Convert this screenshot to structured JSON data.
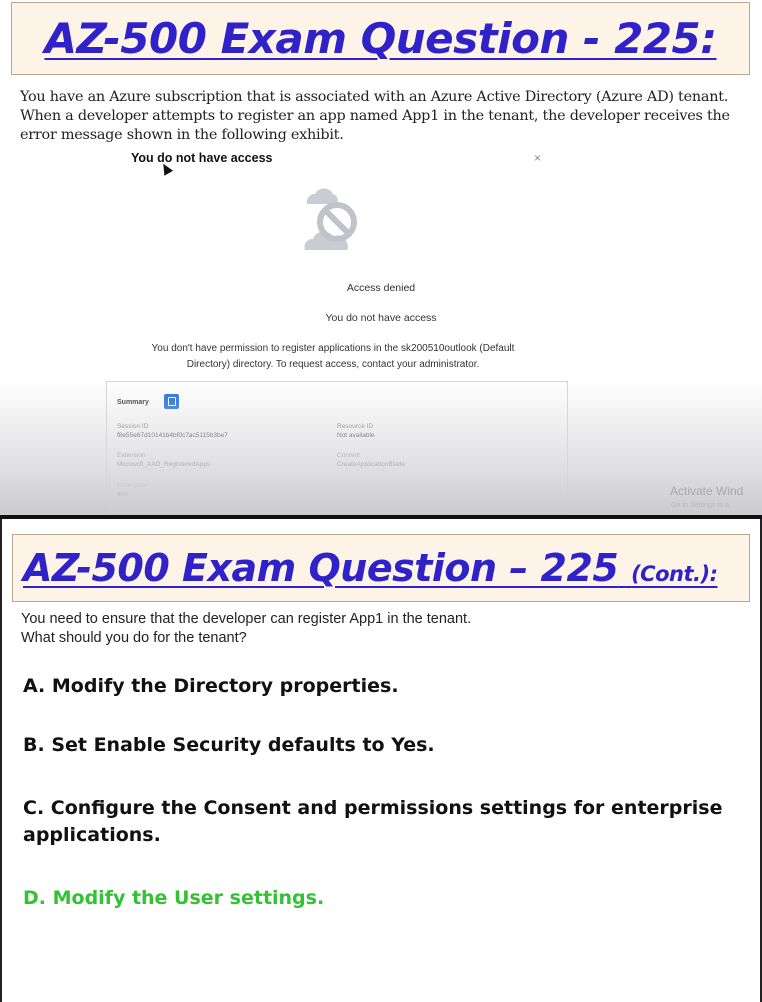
{
  "slide1": {
    "title": "AZ-500 Exam Question - 225:",
    "question_lines": [
      "You have an Azure subscription that is associated with an Azure Active Directory (Azure AD) tenant.",
      "When a developer attempts to register an app named App1 in the tenant, the developer receives the",
      "error message shown in the following exhibit."
    ],
    "exhibit": {
      "title": "You do not have access",
      "close_glyph": "×",
      "icon": "cloud-blocked-icon",
      "heading": "Access denied",
      "subheading": "You do not have access",
      "description_lines": [
        "You don't have permission to register applications in the sk200510outlook (Default",
        "Directory) directory. To request access, contact your administrator."
      ],
      "summary": {
        "label": "Summary",
        "session_id_label": "Session ID",
        "session_id_value": "f8e55e67d10141b4bf0c7ac5115b3be7",
        "resource_id_label": "Resource ID",
        "resource_id_value": "Not available",
        "extension_label": "Extension",
        "extension_value": "Microsoft_AAD_RegisteredApps",
        "content_label": "Content",
        "content_value": "CreateApplicationBlade",
        "error_code_label": "Error code",
        "error_code_value": "403"
      }
    },
    "watermark": "Activate Wind",
    "watermark_sub": "Go to Settings to a"
  },
  "slide2": {
    "title_main": "AZ-500 Exam Question – 225",
    "title_suffix": "(Cont.):",
    "question_lines": [
      "You need to ensure that the developer can register App1 in the tenant.",
      "What should you do for the tenant?"
    ],
    "options": [
      "A.  Modify the Directory properties.",
      "B.  Set Enable Security defaults to Yes.",
      "C.  Configure the Consent and permissions settings for enterprise",
      "applications.",
      "D.  Modify the User settings."
    ],
    "correct_color": "#33c233"
  }
}
